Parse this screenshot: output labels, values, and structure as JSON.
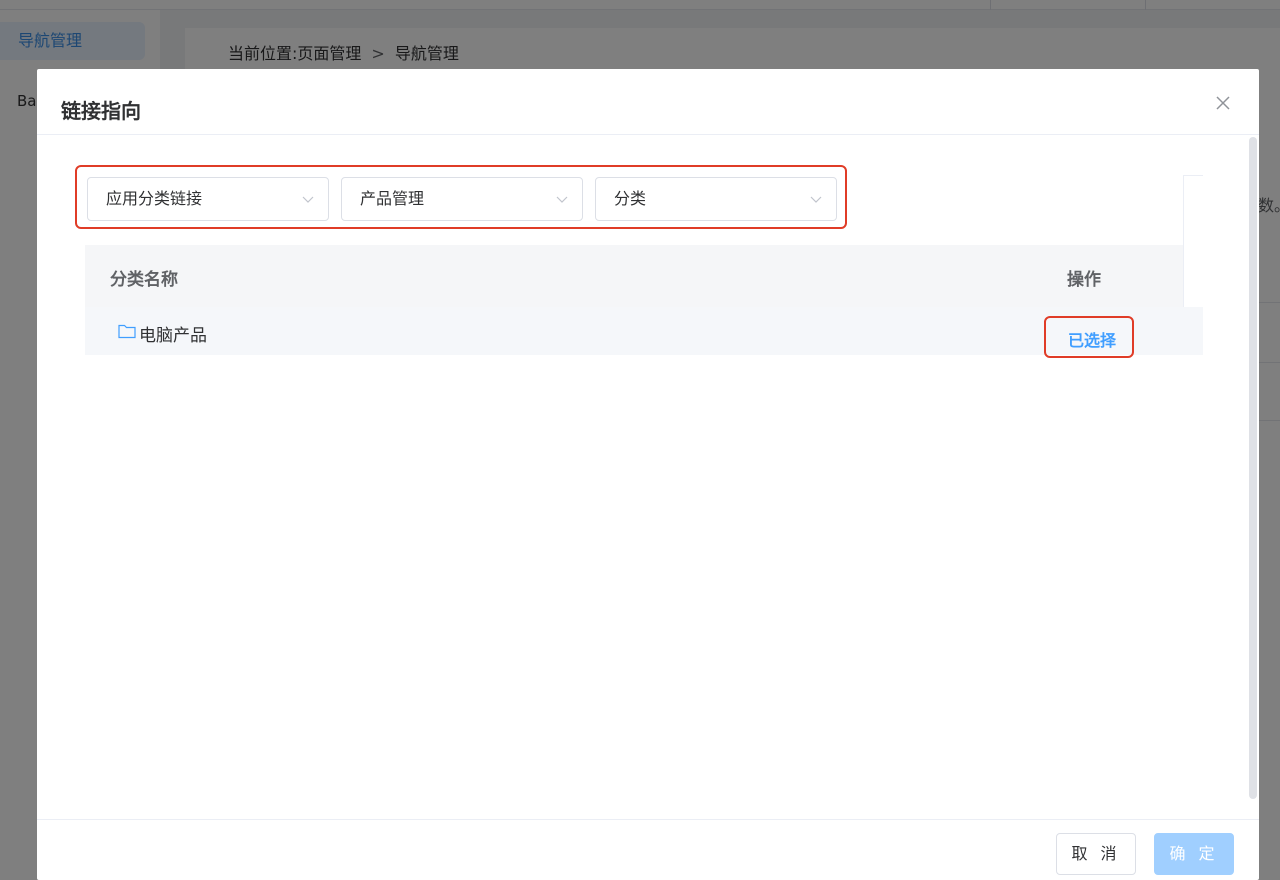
{
  "background": {
    "sidebar_active_item": "导航管理",
    "sidebar_partial_item": "Ba",
    "breadcrumb": {
      "prefix": "当前位置:",
      "parent": "页面管理",
      "separator": ">",
      "current": "导航管理"
    },
    "peek_text": "数。"
  },
  "dialog": {
    "title": "链接指向",
    "close_icon": "close-icon",
    "selects": [
      {
        "value": "应用分类链接"
      },
      {
        "value": "产品管理"
      },
      {
        "value": "分类"
      }
    ],
    "table": {
      "headers": {
        "name": "分类名称",
        "action": "操作"
      },
      "rows": [
        {
          "name": "电脑产品",
          "icon": "folder-icon",
          "action": "已选择"
        }
      ]
    },
    "footer": {
      "cancel_label": "取 消",
      "confirm_label": "确 定"
    }
  },
  "colors": {
    "accent": "#409eff",
    "highlight_border": "#e03c27",
    "confirm_disabled": "#a0cfff"
  }
}
